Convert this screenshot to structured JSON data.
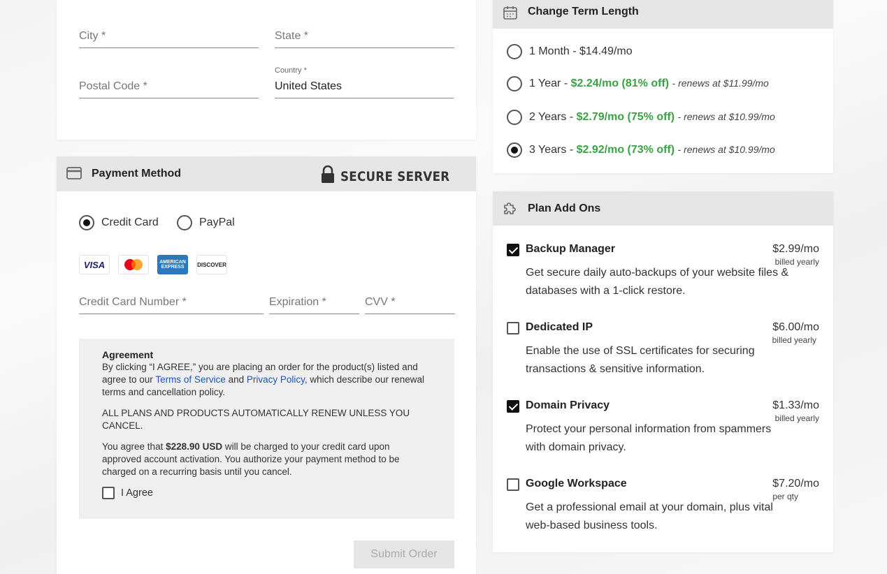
{
  "address": {
    "city_placeholder": "City *",
    "state_placeholder": "State *",
    "postal_placeholder": "Postal Code *",
    "country_label": "Country *",
    "country_value": "United States"
  },
  "payment": {
    "title": "Payment Method",
    "secure_text": "SECURE SERVER",
    "methods": [
      {
        "label": "Credit Card",
        "selected": true
      },
      {
        "label": "PayPal",
        "selected": false
      }
    ],
    "card_brands": [
      "VISA",
      "mastercard",
      "AMERICAN EXPRESS",
      "DISCOVER"
    ],
    "cc_number_placeholder": "Credit Card Number *",
    "expiration_placeholder": "Expiration *",
    "cvv_placeholder": "CVV *",
    "agreement": {
      "title": "Agreement",
      "p1_a": "By clicking “I AGREE,” you are placing an order for the product(s) listed and agree to our ",
      "tos_link": "Terms of Service",
      "p1_b": " and ",
      "privacy_link": "Privacy Policy",
      "p1_c": ", which describe our renewal terms and cancellation policy.",
      "p2": "ALL PLANS AND PRODUCTS AUTOMATICALLY RENEW UNLESS YOU CANCEL.",
      "p3_a": "You agree that ",
      "p3_amount": "$228.90 USD",
      "p3_b": " will be charged to your credit card upon approved account activation. You authorize your payment method to be charged on a recurring basis until you cancel.",
      "agree_label": "I Agree",
      "agree_checked": false
    },
    "submit_label": "Submit Order"
  },
  "term": {
    "title": "Change Term Length",
    "options": [
      {
        "label": "1 Month - $14.49/mo",
        "deal": "",
        "renews": "",
        "selected": false
      },
      {
        "label": "1 Year - ",
        "deal": "$2.24/mo (81% off)",
        "renews": "- renews at $11.99/mo",
        "selected": false
      },
      {
        "label": "2 Years - ",
        "deal": "$2.79/mo (75% off)",
        "renews": "- renews at $10.99/mo",
        "selected": false
      },
      {
        "label": "3 Years - ",
        "deal": "$2.92/mo (73% off)",
        "renews": "- renews at $10.99/mo",
        "selected": true
      }
    ]
  },
  "addons": {
    "title": "Plan Add Ons",
    "items": [
      {
        "name": "Backup Manager",
        "price": "$2.99/mo",
        "billed": "billed yearly",
        "desc": "Get secure daily auto-backups of your website files & databases with a 1-click restore.",
        "checked": true
      },
      {
        "name": "Dedicated IP",
        "price": "$6.00/mo",
        "billed": "billed yearly",
        "desc": "Enable the use of SSL certificates for securing transactions & sensitive information.",
        "checked": false
      },
      {
        "name": "Domain Privacy",
        "price": "$1.33/mo",
        "billed": "billed yearly",
        "desc": "Protect your personal information from spammers with domain privacy.",
        "checked": true
      },
      {
        "name": "Google Workspace",
        "price": "$7.20/mo",
        "billed": "per qty",
        "desc": "Get a professional email at your domain, plus vital web-based business tools.",
        "checked": false
      }
    ]
  },
  "colors": {
    "green": "#3aa245",
    "link": "#1a56b6",
    "header_bg": "#e5e5e5",
    "agree_bg": "#efefef"
  }
}
